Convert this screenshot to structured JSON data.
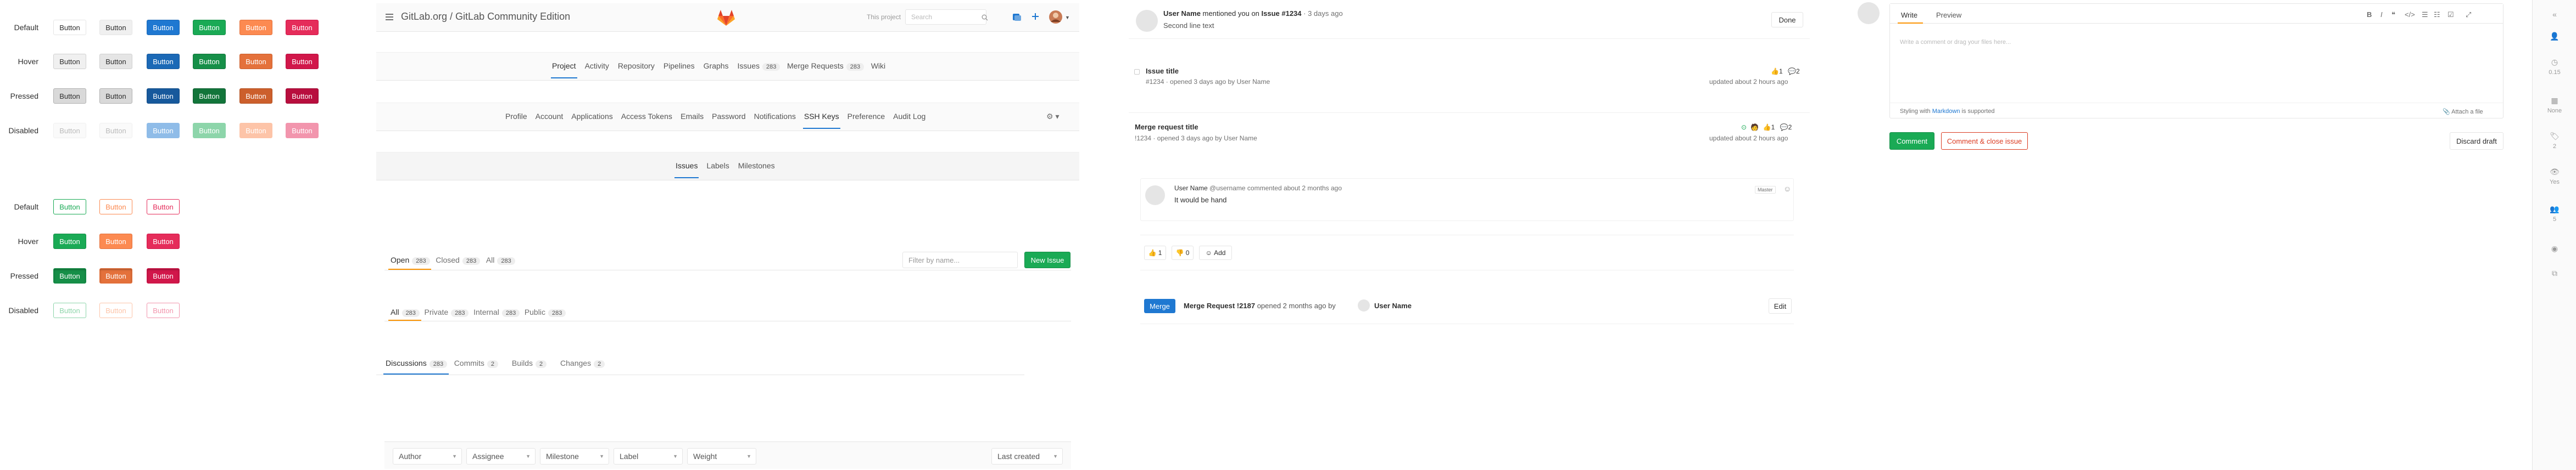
{
  "buttons_filled": {
    "row_labels": [
      "Default",
      "Hover",
      "Pressed",
      "Disabled"
    ],
    "label": "Button",
    "variants": [
      "default",
      "secondary",
      "primary",
      "success",
      "warning",
      "danger"
    ]
  },
  "buttons_outline": {
    "row_labels": [
      "Default",
      "Hover",
      "Pressed",
      "Disabled"
    ],
    "label": "Button",
    "variants": [
      "success",
      "warning",
      "danger"
    ]
  },
  "colors": {
    "primary": "#1f78d1",
    "success": "#1aaa55",
    "warning": "#fc9403",
    "danger": "#db3b21",
    "pink": "#e52c5a"
  },
  "header": {
    "title": "GitLab.org / GitLab Community Edition",
    "this_project": "This project",
    "search_placeholder": "Search",
    "icons": [
      "search-icon",
      "todo-icon",
      "plus-icon",
      "avatar-icon",
      "chevron-down-icon"
    ]
  },
  "project_nav": {
    "items": [
      {
        "label": "Project",
        "active": true
      },
      {
        "label": "Activity"
      },
      {
        "label": "Repository"
      },
      {
        "label": "Pipelines"
      },
      {
        "label": "Graphs"
      },
      {
        "label": "Issues",
        "count": "283"
      },
      {
        "label": "Merge Requests",
        "count": "283"
      },
      {
        "label": "Wiki"
      }
    ]
  },
  "settings_nav": {
    "items": [
      {
        "label": "Profile"
      },
      {
        "label": "Account"
      },
      {
        "label": "Applications"
      },
      {
        "label": "Access Tokens"
      },
      {
        "label": "Emails"
      },
      {
        "label": "Password"
      },
      {
        "label": "Notifications"
      },
      {
        "label": "SSH Keys",
        "active": true
      },
      {
        "label": "Preference"
      },
      {
        "label": "Audit Log"
      }
    ],
    "gear_icon": "gear-icon"
  },
  "sub_nav": {
    "items": [
      {
        "label": "Issues",
        "active": true
      },
      {
        "label": "Labels"
      },
      {
        "label": "Milestones"
      }
    ]
  },
  "issues_tabs": {
    "items": [
      {
        "label": "Open",
        "count": "283",
        "active": true
      },
      {
        "label": "Closed",
        "count": "283"
      },
      {
        "label": "All",
        "count": "283"
      }
    ],
    "filter_placeholder": "Filter by name...",
    "new_issue": "New Issue"
  },
  "visibility_tabs": {
    "items": [
      {
        "label": "All",
        "count": "283",
        "active": true
      },
      {
        "label": "Private",
        "count": "283"
      },
      {
        "label": "Internal",
        "count": "283"
      },
      {
        "label": "Public",
        "count": "283"
      }
    ]
  },
  "mr_tabs": {
    "items": [
      {
        "label": "Discussions",
        "count": "283",
        "active": true
      },
      {
        "label": "Commits",
        "count": "2"
      },
      {
        "label": "Builds",
        "count": "2"
      },
      {
        "label": "Changes",
        "count": "2"
      }
    ]
  },
  "filters": {
    "dropdowns": [
      "Author",
      "Assignee",
      "Milestone",
      "Label",
      "Weight"
    ],
    "sort": "Last created"
  },
  "todo": {
    "author": "User Name",
    "text": " mentioned you on ",
    "target": "Issue #1234",
    "time": " · 3 days ago",
    "body": "Second line text",
    "done": "Done"
  },
  "issue_item": {
    "title": "Issue title",
    "meta": "#1234 · opened 3 days ago by User Name",
    "updated": "updated about 2 hours ago",
    "upvotes": "1",
    "comments": "2"
  },
  "mr_item": {
    "title": "Merge request title",
    "meta": "!1234 · opened 3 days ago by User Name",
    "updated": "updated about 2 hours ago",
    "upvotes": "1",
    "comments": "2"
  },
  "note": {
    "author": "User Name",
    "handle": "@username",
    "action": "commented about 2 months ago",
    "badge": "Master",
    "body": "It would be hand"
  },
  "awards": {
    "thumbsup": "1",
    "thumbsdown": "0",
    "add": "Add"
  },
  "mr_header": {
    "badge": "Merge",
    "title": "Merge Request !2187",
    "opened": "opened 2 months ago by",
    "author": "User Name",
    "edit": "Edit"
  },
  "comment_form": {
    "tabs": [
      "Write",
      "Preview"
    ],
    "placeholder": "Write a comment or drag your files here...",
    "hint_prefix": "Styling with ",
    "hint_link": "Markdown",
    "hint_suffix": " is supported",
    "attach": "Attach a file",
    "comment": "Comment",
    "close": "Comment & close issue",
    "discard": "Discard draft",
    "toolbar_icons": [
      "bold-icon",
      "italic-icon",
      "quote-icon",
      "code-icon",
      "list-ul-icon",
      "list-ol-icon",
      "checklist-icon",
      "fullscreen-icon"
    ]
  },
  "sidebar": {
    "items": [
      {
        "icon": "collapse-icon",
        "label": ""
      },
      {
        "icon": "user-icon",
        "label": ""
      },
      {
        "icon": "clock-icon",
        "label": "0.15"
      },
      {
        "icon": "calendar-icon",
        "label": "None"
      },
      {
        "icon": "tag-icon",
        "label": "2"
      },
      {
        "icon": "eye-icon",
        "label": "Yes"
      },
      {
        "icon": "users-icon",
        "label": "5"
      },
      {
        "icon": "rss-icon",
        "label": ""
      },
      {
        "icon": "copy-icon",
        "label": ""
      }
    ]
  }
}
